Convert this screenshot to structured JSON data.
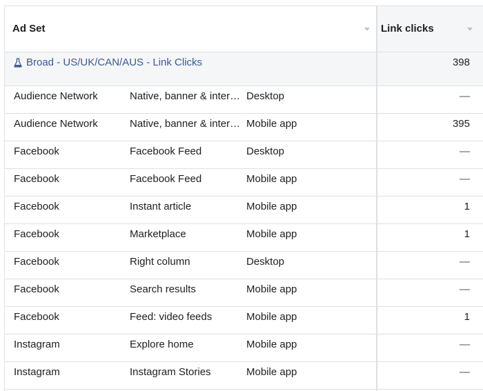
{
  "header": {
    "col_adset": "Ad Set",
    "col_link_clicks": "Link clicks"
  },
  "summary": {
    "name": "Broad - US/UK/CAN/AUS - Link Clicks",
    "link_clicks": "398"
  },
  "rows": [
    {
      "platform": "Audience Network",
      "placement": "Native, banner & interstitial",
      "device": "Desktop",
      "link_clicks": "—"
    },
    {
      "platform": "Audience Network",
      "placement": "Native, banner & interstitial",
      "device": "Mobile app",
      "link_clicks": "395"
    },
    {
      "platform": "Facebook",
      "placement": "Facebook Feed",
      "device": "Desktop",
      "link_clicks": "—"
    },
    {
      "platform": "Facebook",
      "placement": "Facebook Feed",
      "device": "Mobile app",
      "link_clicks": "—"
    },
    {
      "platform": "Facebook",
      "placement": "Instant article",
      "device": "Mobile app",
      "link_clicks": "1"
    },
    {
      "platform": "Facebook",
      "placement": "Marketplace",
      "device": "Mobile app",
      "link_clicks": "1"
    },
    {
      "platform": "Facebook",
      "placement": "Right column",
      "device": "Desktop",
      "link_clicks": "—"
    },
    {
      "platform": "Facebook",
      "placement": "Search results",
      "device": "Mobile app",
      "link_clicks": "—"
    },
    {
      "platform": "Facebook",
      "placement": "Feed: video feeds",
      "device": "Mobile app",
      "link_clicks": "1"
    },
    {
      "platform": "Instagram",
      "placement": "Explore home",
      "device": "Mobile app",
      "link_clicks": "—"
    },
    {
      "platform": "Instagram",
      "placement": "Instagram Stories",
      "device": "Mobile app",
      "link_clicks": "—"
    }
  ],
  "icons": {
    "summary_icon": "flask-icon",
    "sort_icon": "chevron-down-icon"
  },
  "colors": {
    "link": "#385898",
    "header_highlight": "#f5f6f7",
    "border": "#dddfe2"
  }
}
